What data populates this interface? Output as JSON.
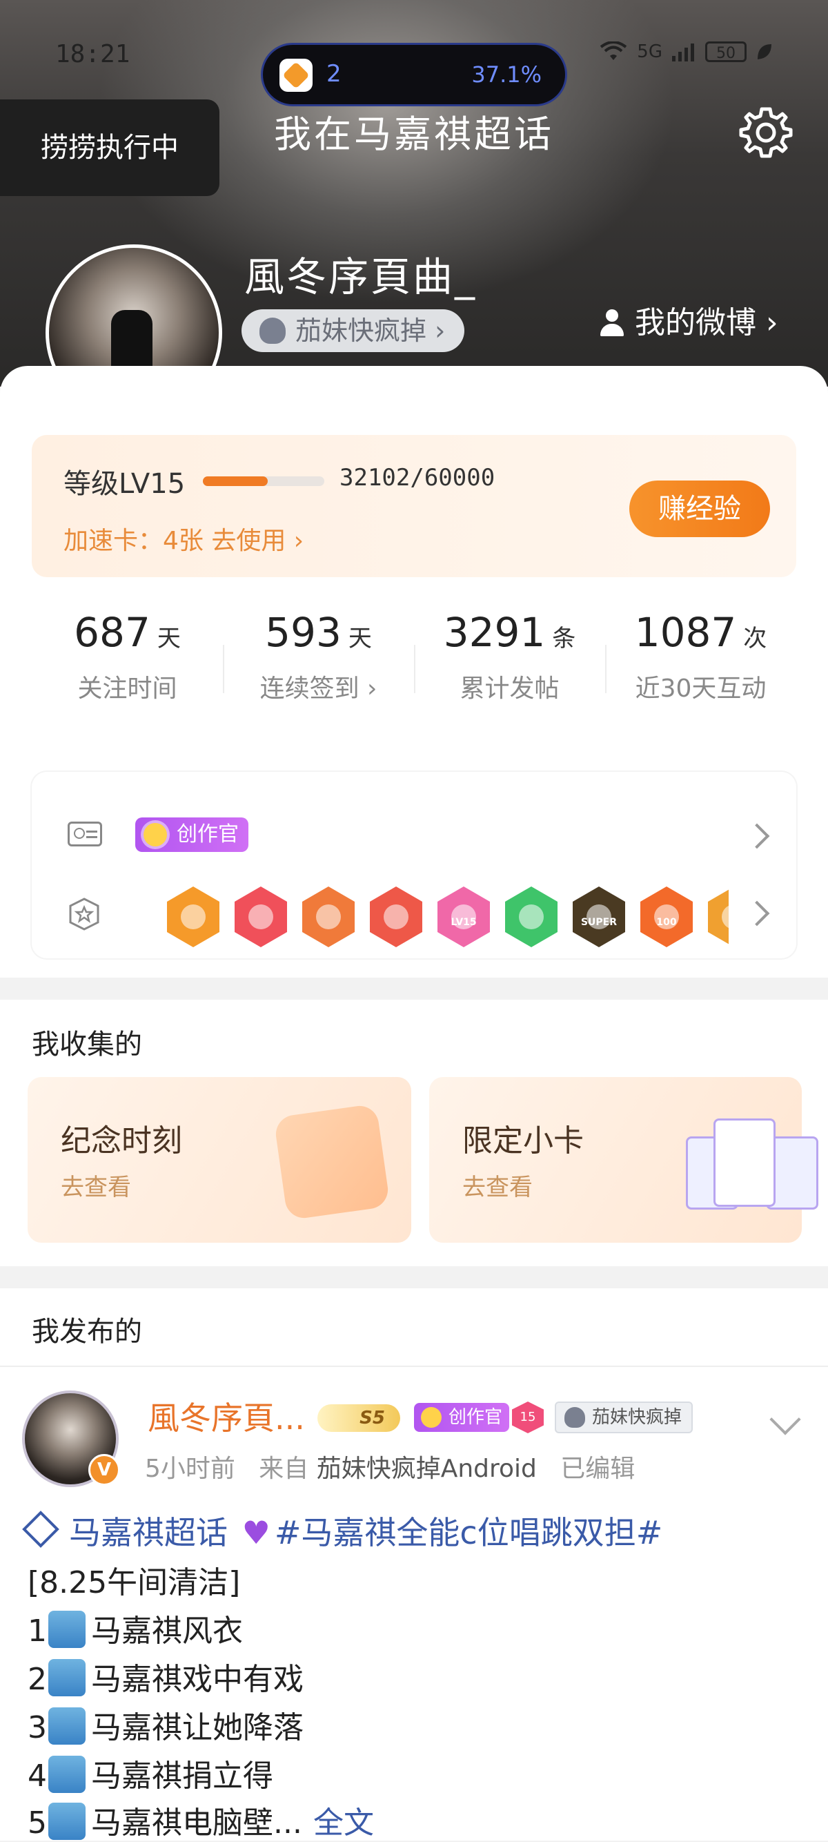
{
  "status_bar": {
    "time": "18:21",
    "live_activity_count": "2",
    "live_activity_percent": "37.1%",
    "network_label": "5G",
    "battery": "50"
  },
  "toast": "捞捞执行中",
  "nav": {
    "title": "我在马嘉祺超话"
  },
  "profile": {
    "username": "風冬序頁曲_",
    "fan_tag": "茄妹快疯掉",
    "weibo_link": "我的微博"
  },
  "level": {
    "label": "等级LV15",
    "progress_text": "32102/60000",
    "progress_fraction": 0.535,
    "speed_card": "加速卡：4张 去使用",
    "earn_button": "赚经验"
  },
  "stats": [
    {
      "value": "687",
      "unit": "天",
      "label": "关注时间"
    },
    {
      "value": "593",
      "unit": "天",
      "label": "连续签到"
    },
    {
      "value": "3291",
      "unit": "条",
      "label": "累计发帖"
    },
    {
      "value": "1087",
      "unit": "次",
      "label": "近30天互动"
    }
  ],
  "badges": {
    "creator_label": "创作官",
    "medals": [
      {
        "color": "#f59a2a",
        "text": ""
      },
      {
        "color": "#f0505a",
        "text": ""
      },
      {
        "color": "#f07a3a",
        "text": ""
      },
      {
        "color": "#ee5848",
        "text": ""
      },
      {
        "color": "#f068a8",
        "text": "LV15"
      },
      {
        "color": "#3fc46a",
        "text": ""
      },
      {
        "color": "#4a3a22",
        "text": "SUPER"
      },
      {
        "color": "#f36a2a",
        "text": "100"
      },
      {
        "color": "#f0a030",
        "text": ""
      }
    ]
  },
  "collected": {
    "title": "我收集的",
    "cards": [
      {
        "title": "纪念时刻",
        "action": "去查看"
      },
      {
        "title": "限定小卡",
        "action": "去查看"
      }
    ]
  },
  "published": {
    "title": "我发布的",
    "post": {
      "author": "風冬序頁...",
      "level_badge": "S5",
      "creator_label": "创作官",
      "level_num": "15",
      "fan_tag": "茄妹快疯掉",
      "time": "5小时前",
      "source_prefix": "来自",
      "source": "茄妹快疯掉Android",
      "edited": "已编辑",
      "topic": "马嘉祺超话",
      "hashtag": "#马嘉祺全能c位唱跳双担#",
      "lines": [
        "[8.25午间清洁]",
        "马嘉祺风衣",
        "马嘉祺戏中有戏",
        "马嘉祺让她降落",
        "马嘉祺捐立得",
        "马嘉祺电脑壁..."
      ],
      "line_numbers": [
        "1",
        "2",
        "3",
        "4",
        "5"
      ],
      "full_text_link": "全文"
    }
  }
}
